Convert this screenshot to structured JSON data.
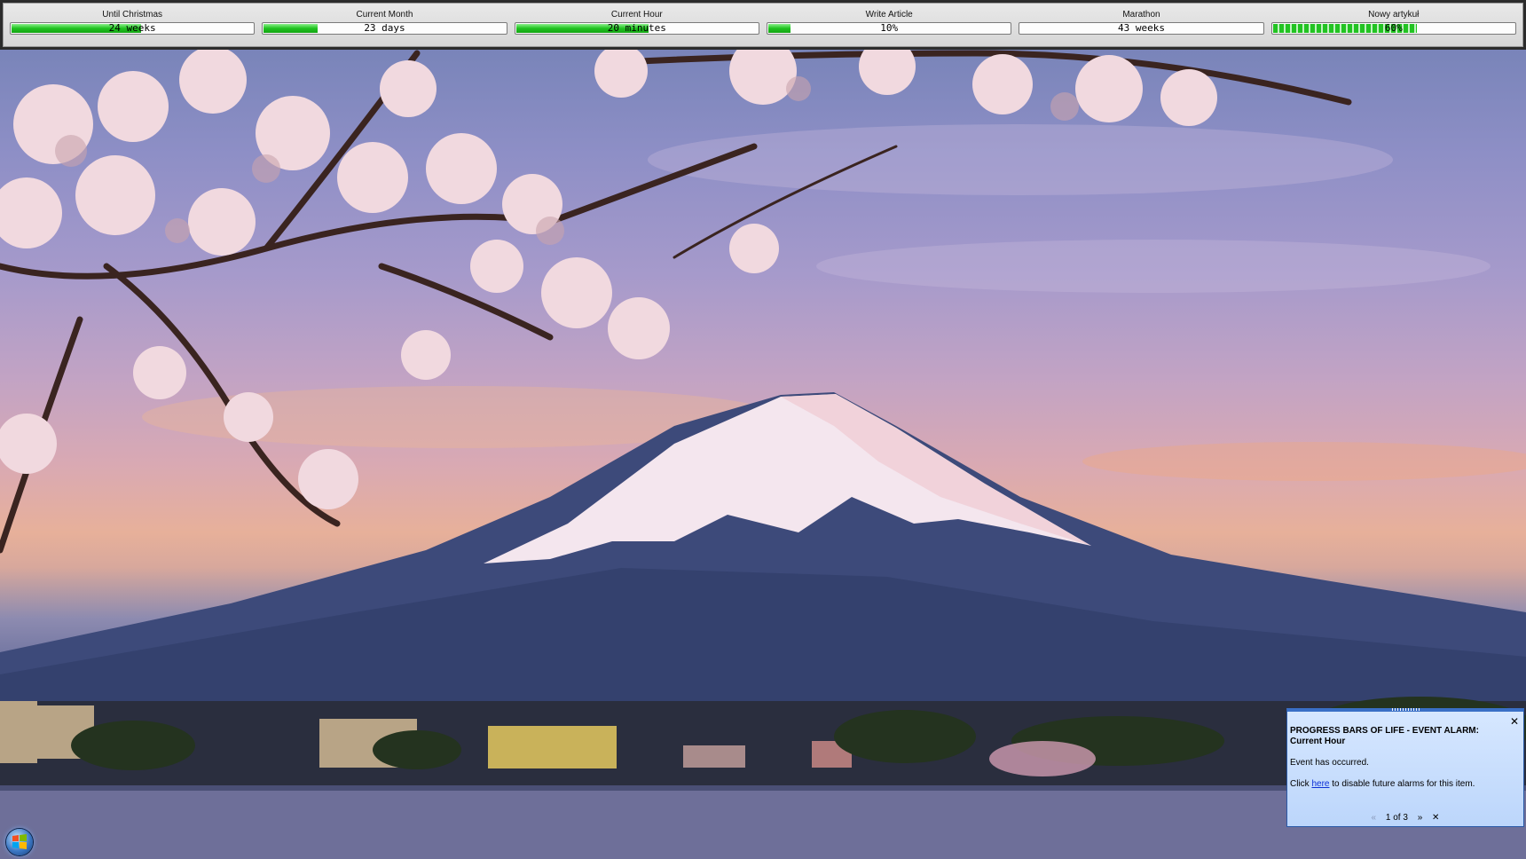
{
  "progress_bars": [
    {
      "title": "Until Christmas",
      "value_text": "24 weeks",
      "fill": 0.54,
      "style": "solid"
    },
    {
      "title": "Current Month",
      "value_text": "23 days",
      "fill": 0.23,
      "style": "solid"
    },
    {
      "title": "Current Hour",
      "value_text": "20 minutes",
      "fill": 0.55,
      "style": "solid"
    },
    {
      "title": "Write Article",
      "value_text": "10%",
      "fill": 0.1,
      "style": "solid"
    },
    {
      "title": "Marathon",
      "value_text": "43 weeks",
      "fill": 0.0,
      "style": "solid"
    },
    {
      "title": "Nowy artykuł",
      "value_text": "60%",
      "fill": 0.6,
      "style": "segmented"
    }
  ],
  "colors": {
    "bar_fill": "#1fc21f",
    "toolbar_bg": "#e0e0e0",
    "popup_bg": "#c8defc",
    "link": "#0b2fd6"
  },
  "alarm": {
    "title": "PROGRESS BARS OF LIFE - EVENT ALARM: Current Hour",
    "message": "Event has occurred.",
    "hint_prefix": "Click ",
    "hint_link": "here",
    "hint_suffix": " to disable future alarms for this item.",
    "pager": "1 of 3",
    "prev_icon": "«",
    "next_icon": "»",
    "close_icon": "✕"
  },
  "taskbar": {
    "start_icon": "windows-start-orb"
  },
  "wallpaper": {
    "subject": "mount-fuji-cherry-blossoms"
  }
}
